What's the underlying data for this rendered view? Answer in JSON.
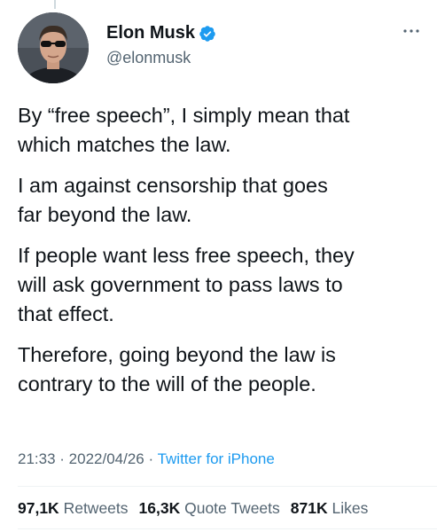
{
  "author": {
    "display_name": "Elon Musk",
    "handle": "@elonmusk",
    "verified": true,
    "verified_color": "#1d9bf0"
  },
  "tweet": {
    "paragraphs": [
      "By “free speech”, I simply mean that\nwhich matches the law.",
      "I am against censorship that goes\nfar beyond the law.",
      "If people want less free speech, they\nwill ask government to pass laws to\nthat effect.",
      "Therefore, going beyond the law is\ncontrary to the will of the people."
    ]
  },
  "meta": {
    "time": "21:33",
    "separator": " · ",
    "date": "2022/04/26",
    "source": "Twitter for iPhone"
  },
  "stats": {
    "retweets_count": "97,1K",
    "retweets_label": "Retweets",
    "quotes_count": "16,3K",
    "quotes_label": "Quote Tweets",
    "likes_count": "871K",
    "likes_label": "Likes"
  },
  "icons": {
    "more": "more-icon",
    "verified": "verified-badge-icon"
  },
  "colors": {
    "text": "#0f1419",
    "secondary": "#536471",
    "link": "#1d9bf0"
  }
}
